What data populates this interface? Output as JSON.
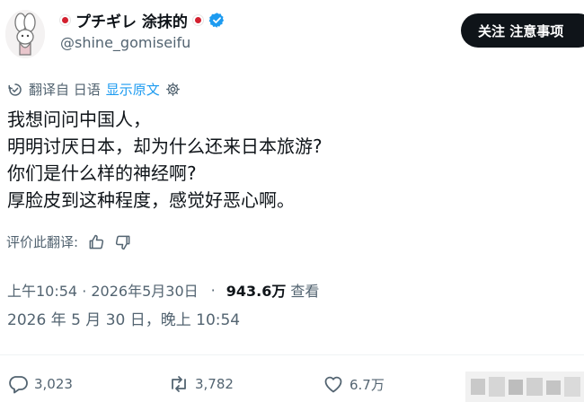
{
  "header": {
    "display_name": "プチギレ 涂抹的",
    "handle": "@shine_gomiseifu",
    "follow_label": "关注 注意事项"
  },
  "translation": {
    "translated_from": "翻译自 日语",
    "show_original": "显示原文"
  },
  "tweet": {
    "lines": [
      "我想问问中国人，",
      "明明讨厌日本，却为什么还来日本旅游?",
      "你们是什么样的神经啊?",
      "厚脸皮到这种程度，感觉好恶心啊。"
    ]
  },
  "rate_translation": {
    "label": "评价此翻译:"
  },
  "meta": {
    "time": "上午10:54 · 2026年5月30日",
    "separator": "·",
    "views": "943.6万",
    "views_label": "查看",
    "full_date": "2026 年 5 月 30 日，晚上 10:54"
  },
  "actions": {
    "replies": "3,023",
    "retweets": "3,782",
    "likes": "6.7万"
  },
  "colors": {
    "text": "#0f1419",
    "secondary": "#536471",
    "link": "#1d9bf0",
    "verified": "#1d9bf0",
    "flag_red": "#d3202f"
  },
  "icons": [
    "translate-icon",
    "settings-icon",
    "thumbs-up-icon",
    "thumbs-down-icon",
    "reply-icon",
    "retweet-icon",
    "like-icon",
    "verified-icon"
  ]
}
